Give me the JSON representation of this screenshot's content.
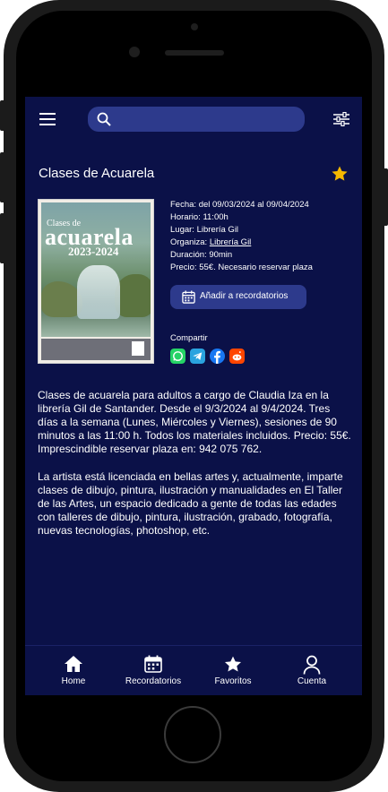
{
  "search": {
    "placeholder": "",
    "value": ""
  },
  "event": {
    "title": "Clases de Acuarela",
    "favorite": true,
    "poster": {
      "small_text": "Clases de",
      "big_text": "acuarela",
      "year_text": "2023-2024"
    },
    "info": {
      "fecha_label": "Fecha:",
      "fecha_value": "del 09/03/2024 al 09/04/2024",
      "horario_label": "Horario:",
      "horario_value": "11:00h",
      "lugar_label": "Lugar:",
      "lugar_value": "Librería Gil",
      "organiza_label": "Organiza:",
      "organiza_value": "Librería Gil",
      "duracion_label": "Duración:",
      "duracion_value": "90min",
      "precio_label": "Precio:",
      "precio_value": "55€. Necesario reservar plaza"
    },
    "reminder_button": "Añadir a recordatorios",
    "share_label": "Compartir",
    "share_icons": [
      "whatsapp-icon",
      "telegram-icon",
      "facebook-icon",
      "reddit-icon"
    ],
    "description_1": "Clases de acuarela para adultos a cargo de Claudia Iza en la librería Gil de Santander. Desde el 9/3/2024 al 9/4/2024. Tres días a la semana (Lunes, Miércoles y Viernes), sesiones de 90 minutos a las 11:00 h. Todos los materiales incluidos. Precio: 55€. Imprescindible reservar plaza en: 942 075 762.",
    "description_2": "La artista está licenciada en bellas artes y, actualmente, imparte clases de dibujo, pintura, ilustración y manualidades en El Taller de las Artes, un espacio dedicado a gente de todas las edades con talleres de dibujo, pintura, ilustración, grabado, fotografía, nuevas tecnologías, photoshop, etc."
  },
  "nav": [
    {
      "label": "Home",
      "icon": "home-icon"
    },
    {
      "label": "Recordatorios",
      "icon": "calendar-icon"
    },
    {
      "label": "Favoritos",
      "icon": "star-icon"
    },
    {
      "label": "Cuenta",
      "icon": "user-icon"
    }
  ],
  "colors": {
    "background": "#0b1148",
    "accent": "#2d3a8c",
    "star": "#f5b800",
    "whatsapp": "#25d366",
    "telegram": "#2aa3df",
    "facebook": "#1877f2",
    "reddit": "#ff4500"
  }
}
